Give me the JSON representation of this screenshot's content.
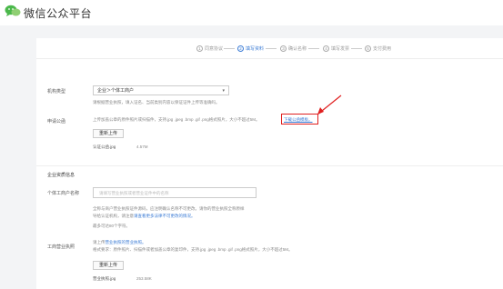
{
  "header": {
    "title": "微信公众平台",
    "logo_icon": "wechat-logo-icon"
  },
  "steps": [
    {
      "num": "1",
      "label": "同意协议"
    },
    {
      "num": "2",
      "label": "填写资料"
    },
    {
      "num": "3",
      "label": "确认名称"
    },
    {
      "num": "4",
      "label": "填写发票"
    },
    {
      "num": "5",
      "label": "支付费用"
    }
  ],
  "form": {
    "org_type": {
      "label": "机构类型",
      "value": "企业＞个体工商户",
      "hint": "请根据营业执照，填入证名、当前类别内容以保证证件上传等准确吗。"
    },
    "application": {
      "label": "申请公函",
      "hint": "上传加盖公章的原件照片或扫描件，支持.jpg .jpeg .bmp .gif .png格式照片，大小不超过5M。",
      "download_link": "下载公函模板。",
      "upload_button": "重新上传",
      "file_name": "认证公函.jpg",
      "file_size": "4.57M"
    },
    "section_title": "企业资质信息",
    "business_name": {
      "label": "个体工商户名称",
      "placeholder": "请填写营业执照或者营业证件中的名称",
      "hint1": "全称与商户营业执照证件源码，应注明确认名称不可更改。请你的营业执照全称原样",
      "hint2": "导给认证机构，请注意",
      "hint2_link": "请查看更多法律不可更改的情况。",
      "hint3": "最多可达80个字符。"
    },
    "license": {
      "label": "工商营业执照",
      "hint1": "请上传",
      "hint1_link": "营业执照的营业执照。",
      "hint2": "格式要求：原件照片、扫描件或者加盖公章的复印件，支持.jpg .jpeg .bmp .gif .png格式照片，大小不超过5M。",
      "upload_button": "重新上传",
      "file_name": "营业执照.jpg",
      "file_size": "253.58K"
    }
  },
  "colors": {
    "accent": "#3a7bd5",
    "highlight": "#e02020",
    "background": "#f3f4f6"
  }
}
